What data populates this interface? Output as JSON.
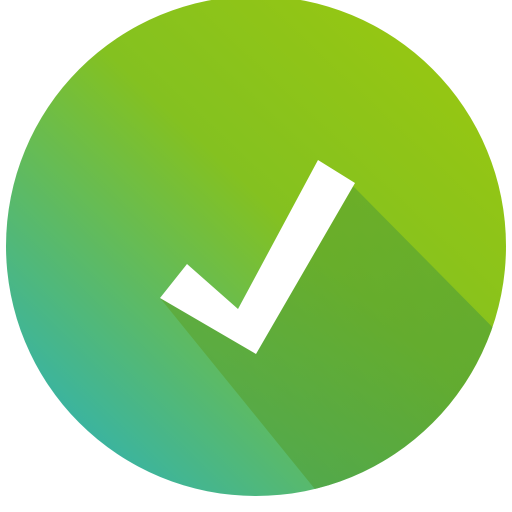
{
  "icon": {
    "name": "checkmark-icon",
    "style": "flat long-shadow checkmark badge"
  },
  "colors": {
    "background": "#ffffff",
    "circle_gradient_top_right": "#97c511",
    "circle_gradient_mid": "#7fbf2a",
    "circle_gradient_bottom_left": "#2fb3b0",
    "long_shadow": "#4f9e34",
    "checkmark": "#ffffff"
  }
}
